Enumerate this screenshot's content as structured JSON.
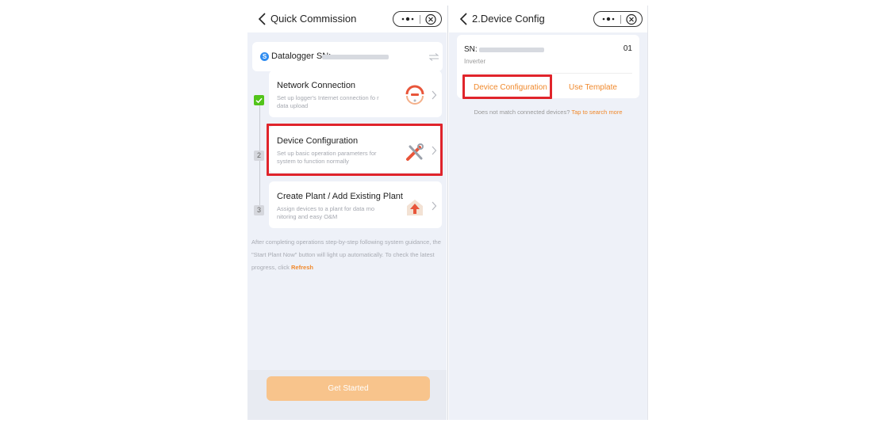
{
  "left_screen": {
    "title": "Quick Commission",
    "datalogger": {
      "label": "Datalogger SN:",
      "badge": "S"
    },
    "steps": [
      {
        "title": "Network Connection",
        "desc": "Set up logger's Internet connection fo r data upload",
        "marker": "✓",
        "status": "done"
      },
      {
        "title": "Device Configuration",
        "desc": "Set up basic operation parameters for system to function normally",
        "marker": "2",
        "status": "current"
      },
      {
        "title": "Create Plant / Add Existing Plant",
        "desc": "Assign devices to a plant for data mo nitoring and easy O&M",
        "marker": "3",
        "status": "pending"
      }
    ],
    "guidance_text": "After completing operations step-by-step following system guidance, the \"Start Plant Now\" button will light up automatically. To check the latest progress, click ",
    "refresh_label": "Refresh",
    "get_started_label": "Get Started"
  },
  "right_screen": {
    "title": "2.Device Config",
    "device": {
      "sn_label": "SN:",
      "address": "01",
      "type": "Inverter"
    },
    "device_config_label": "Device Configuration",
    "use_template_label": "Use Template",
    "hint_text": "Does not match connected devices? ",
    "tap_label": "Tap to search more"
  },
  "colors": {
    "accent": "#f0892c",
    "highlight": "#e0242b",
    "done": "#52c41a",
    "panel_bg": "#eef1f8"
  }
}
